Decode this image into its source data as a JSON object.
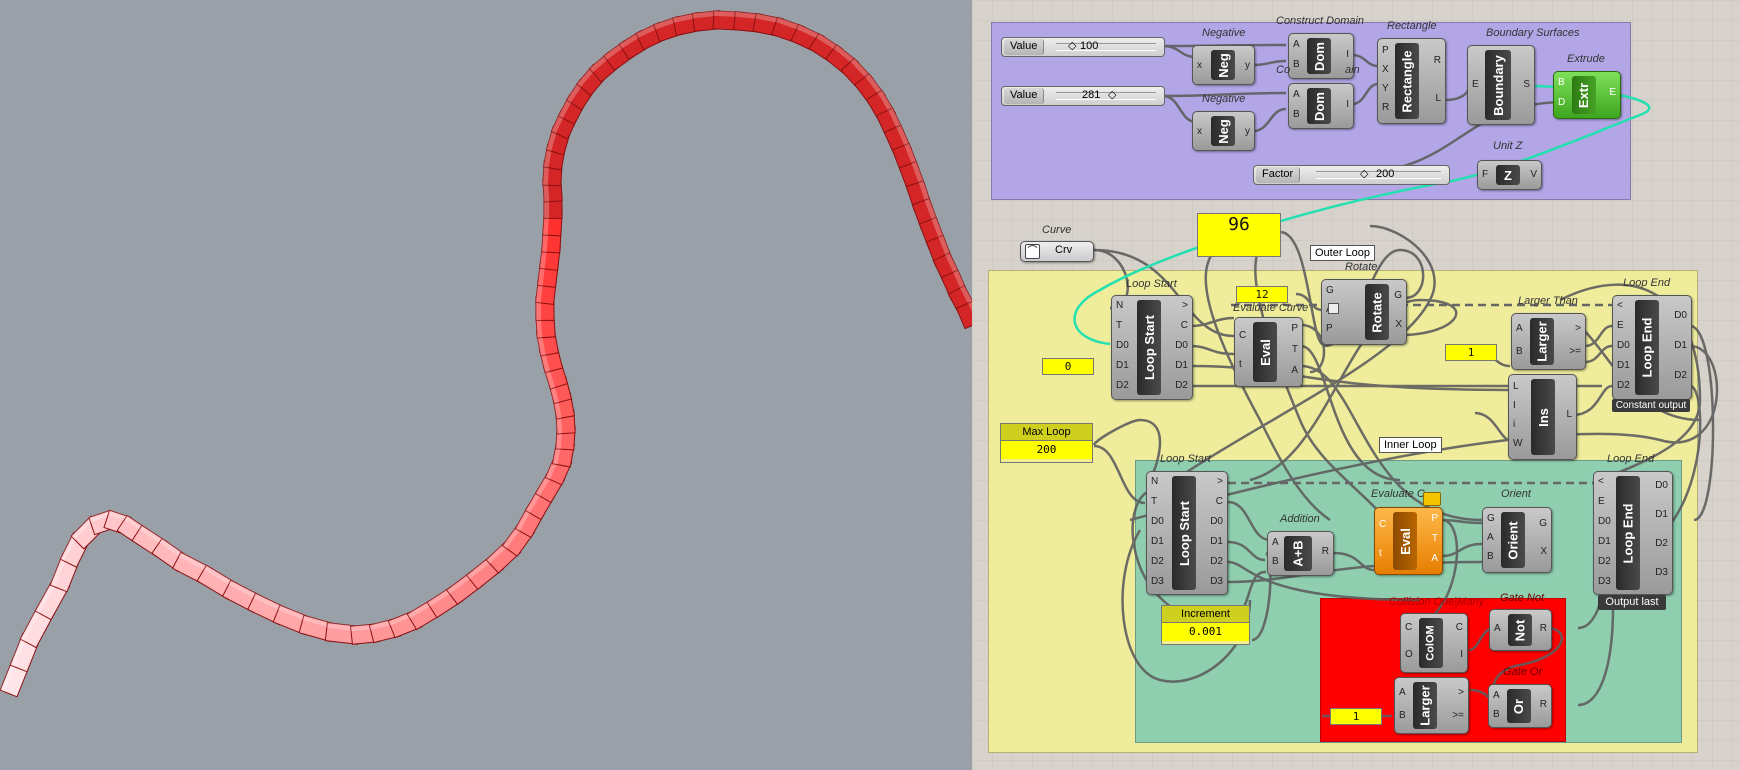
{
  "viewport": {
    "label": "Rhino viewport – brick path along curve"
  },
  "groups": {
    "outer": {
      "color": "#efed9c"
    },
    "inner": {
      "color": "#8fcfb0"
    },
    "purple": {
      "color": "#b3a6e6"
    },
    "collision": {
      "color": "#ff0000"
    }
  },
  "sliders": {
    "value1": {
      "label": "Value",
      "value": "100"
    },
    "value2": {
      "label": "Value",
      "value": "281"
    },
    "factor": {
      "label": "Factor",
      "value": "200"
    }
  },
  "titles": {
    "construct_domain": "Construct Domain",
    "construct_domain2": "Co",
    "construct_domain2b": "ain",
    "rectangle": "Rectangle",
    "boundary_surfaces": "Boundary Surfaces",
    "extrude": "Extrude",
    "negative1": "Negative",
    "negative2": "Negative",
    "unit_z": "Unit Z",
    "curve": "Curve",
    "loop_start1": "Loop Start",
    "evaluate_curve1": "Evaluate Curve",
    "rotate": "Rotate",
    "larger_than": "Larger Than",
    "loop_end1": "Loop End",
    "loop_start2": "Loop Start",
    "addition": "Addition",
    "evaluate_curve2": "Evaluate C",
    "orient": "Orient",
    "loop_end2": "Loop End",
    "collision": "Collision One|Many",
    "gate_not": "Gate Not",
    "gate_or": "Gate Or"
  },
  "components": {
    "neg1": {
      "core": "Neg",
      "inputs": [
        "x"
      ],
      "outputs": [
        "y"
      ]
    },
    "neg2": {
      "core": "Neg",
      "inputs": [
        "x"
      ],
      "outputs": [
        "y"
      ]
    },
    "dom1": {
      "core": "Dom",
      "inputs": [
        "A",
        "B"
      ],
      "outputs": [
        "I"
      ]
    },
    "dom2": {
      "core": "Dom",
      "inputs": [
        "A",
        "B"
      ],
      "outputs": [
        "I"
      ]
    },
    "rect": {
      "core": "Rectangle",
      "inputs": [
        "P",
        "X",
        "Y",
        "R"
      ],
      "outputs": [
        "R",
        "L"
      ]
    },
    "boundary": {
      "core": "Boundary",
      "inputs": [
        "E"
      ],
      "outputs": [
        "S"
      ]
    },
    "extr": {
      "core": "Extr",
      "inputs": [
        "B",
        "D"
      ],
      "outputs": [
        "E"
      ]
    },
    "unitz": {
      "core": "Z",
      "inputs": [
        "F"
      ],
      "outputs": [
        "V"
      ]
    },
    "crv": {
      "core": "Crv"
    },
    "loopstart1": {
      "core": "Loop Start",
      "inputs": [
        "N",
        "T",
        "D0",
        "D1",
        "D2"
      ],
      "outputs": [
        ">",
        "C",
        "D0",
        "D1",
        "D2"
      ]
    },
    "eval1": {
      "core": "Eval",
      "inputs": [
        "C",
        "t"
      ],
      "outputs": [
        "P",
        "T",
        "A"
      ]
    },
    "rotate": {
      "core": "Rotate",
      "inputs": [
        "G",
        "A",
        "P"
      ],
      "outputs": [
        "G",
        "X"
      ]
    },
    "larger1": {
      "core": "Larger",
      "inputs": [
        "A",
        "B"
      ],
      "outputs": [
        ">",
        ">="
      ]
    },
    "loopend1": {
      "core": "Loop End",
      "inputs": [
        "<",
        "E",
        "D0",
        "D1",
        "D2"
      ],
      "outputs": [
        "D0",
        "D1",
        "D2"
      ]
    },
    "ins": {
      "core": "Ins",
      "inputs": [
        "L",
        "I",
        "i",
        "W"
      ],
      "outputs": [
        "L"
      ]
    },
    "loopstart2": {
      "core": "Loop Start",
      "inputs": [
        "N",
        "T",
        "D0",
        "D1",
        "D2",
        "D3"
      ],
      "outputs": [
        ">",
        "C",
        "D0",
        "D1",
        "D2",
        "D3"
      ]
    },
    "add": {
      "core": "A+B",
      "inputs": [
        "A",
        "B"
      ],
      "outputs": [
        "R"
      ]
    },
    "eval2": {
      "core": "Eval",
      "inputs": [
        "C",
        "t"
      ],
      "outputs": [
        "P",
        "T",
        "A"
      ]
    },
    "orient": {
      "core": "Orient",
      "inputs": [
        "G",
        "A",
        "B"
      ],
      "outputs": [
        "G",
        "X"
      ]
    },
    "loopend2": {
      "core": "Loop End",
      "inputs": [
        "<",
        "E",
        "D0",
        "D1",
        "D2",
        "D3"
      ],
      "outputs": [
        "D0",
        "D1",
        "D2",
        "D3"
      ]
    },
    "colom": {
      "core": "ColOM",
      "inputs": [
        "C",
        "O"
      ],
      "outputs": [
        "C",
        "I"
      ]
    },
    "not": {
      "core": "Not",
      "inputs": [
        "A"
      ],
      "outputs": [
        "R"
      ]
    },
    "larger2": {
      "core": "Larger",
      "inputs": [
        "A",
        "B"
      ],
      "outputs": [
        ">",
        ">="
      ]
    },
    "or": {
      "core": "Or",
      "inputs": [
        "A",
        "B"
      ],
      "outputs": [
        "R"
      ]
    }
  },
  "panels": {
    "p96": "96",
    "p12": "12",
    "p0": "0",
    "p1a": "1",
    "p1b": "1"
  },
  "maxloop": {
    "header": "Max Loop",
    "value": "200"
  },
  "increment": {
    "header": "Increment",
    "value": "0.001"
  },
  "tags": {
    "outer": "Outer Loop",
    "inner": "Inner Loop"
  },
  "sublabels": {
    "constant": "Constant output",
    "output_last": "Output last"
  }
}
